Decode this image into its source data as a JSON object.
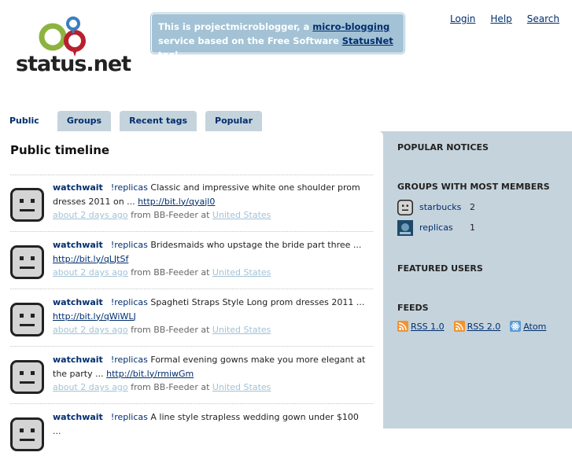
{
  "header": {
    "logo_text": "status.net",
    "site_notice": {
      "pre": "This is projectmicroblogger, a ",
      "link1": "micro-blogging",
      "mid": " service based on the Free Software ",
      "link2": "StatusNet",
      "post": " tool."
    },
    "nav": {
      "login": "Login",
      "help": "Help",
      "search": "Search"
    }
  },
  "tabs": [
    {
      "label": "Public",
      "active": true
    },
    {
      "label": "Groups"
    },
    {
      "label": "Recent tags"
    },
    {
      "label": "Popular"
    }
  ],
  "main": {
    "title": "Public timeline",
    "notices": [
      {
        "author": "watchwait",
        "tag": "!replicas",
        "text": " Classic and impressive white one shoulder prom dresses 2011 on ... ",
        "link": "http://bit.ly/qyajl0",
        "time": "about 2 days ago",
        "source": " from BB-Feeder at ",
        "location": "United States"
      },
      {
        "author": "watchwait",
        "tag": "!replicas",
        "text": " Bridesmaids who upstage the bride part three ... ",
        "link": "http://bit.ly/qLJtSf",
        "time": "about 2 days ago",
        "source": " from BB-Feeder at ",
        "location": "United States"
      },
      {
        "author": "watchwait",
        "tag": "!replicas",
        "text": " Spagheti Straps Style Long prom dresses 2011 ... ",
        "link": "http://bit.ly/qWiWLJ",
        "time": "about 2 days ago",
        "source": " from BB-Feeder at ",
        "location": "United States"
      },
      {
        "author": "watchwait",
        "tag": "!replicas",
        "text": " Formal evening gowns make you more elegant at the party ... ",
        "link": "http://bit.ly/rmiwGm",
        "time": "about 2 days ago",
        "source": " from BB-Feeder at ",
        "location": "United States"
      },
      {
        "author": "watchwait",
        "tag": "!replicas",
        "text": " A line style strapless wedding gown under $100 ...",
        "link": "",
        "time": "",
        "source": "",
        "location": ""
      }
    ]
  },
  "sidebar": {
    "popular_notices": "POPULAR NOTICES",
    "groups_title": "GROUPS WITH MOST MEMBERS",
    "groups": [
      {
        "name": "starbucks",
        "count": "2"
      },
      {
        "name": "replicas",
        "count": "1"
      }
    ],
    "featured_users": "FEATURED USERS",
    "feeds_title": "FEEDS",
    "feeds": [
      {
        "label": "RSS 1.0",
        "icon": "rss-icon"
      },
      {
        "label": "RSS 2.0",
        "icon": "rss-icon"
      },
      {
        "label": "Atom",
        "icon": "atom-icon"
      }
    ]
  },
  "colors": {
    "accent": "#002e6e",
    "panel": "#c5d3dc",
    "notice_bg": "#a3c2d5"
  }
}
